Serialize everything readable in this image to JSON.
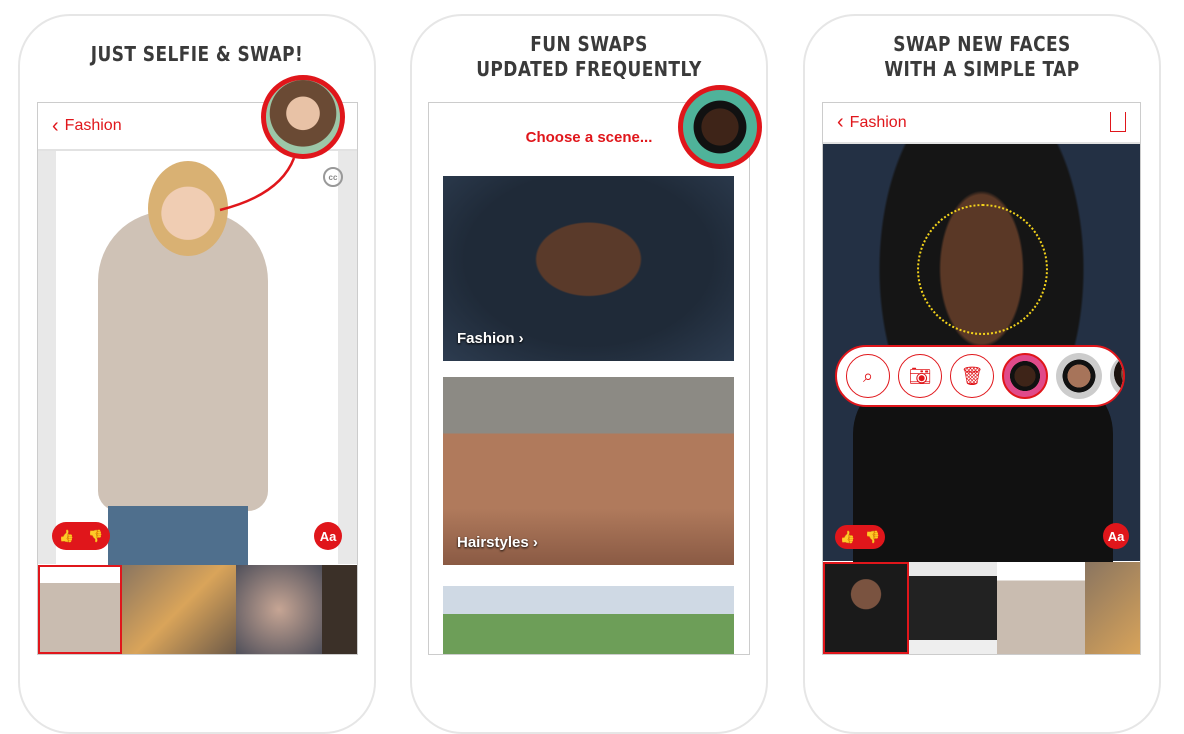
{
  "panels": [
    {
      "headline": [
        "JUST SELFIE & SWAP!"
      ],
      "header": {
        "back_label": "Fashion"
      },
      "cc_badge": "cc",
      "aa_button": "Aa"
    },
    {
      "headline": [
        "FUN SWAPS",
        "UPDATED FREQUENTLY"
      ],
      "prompt": "Choose a scene...",
      "scenes": [
        {
          "label": "Fashion"
        },
        {
          "label": "Hairstyles"
        }
      ]
    },
    {
      "headline": [
        "SWAP NEW FACES",
        "WITH A SIMPLE TAP"
      ],
      "header": {
        "back_label": "Fashion"
      },
      "aa_button": "Aa"
    }
  ],
  "icons": {
    "back": "chevron-left-icon",
    "share": "share-icon",
    "search": "search-icon",
    "camera": "camera-icon",
    "trash": "trash-icon",
    "like": "thumbs-up-icon",
    "dislike": "thumbs-down-icon"
  },
  "colors": {
    "accent": "#e0161b",
    "headline": "#3a3a3a"
  }
}
